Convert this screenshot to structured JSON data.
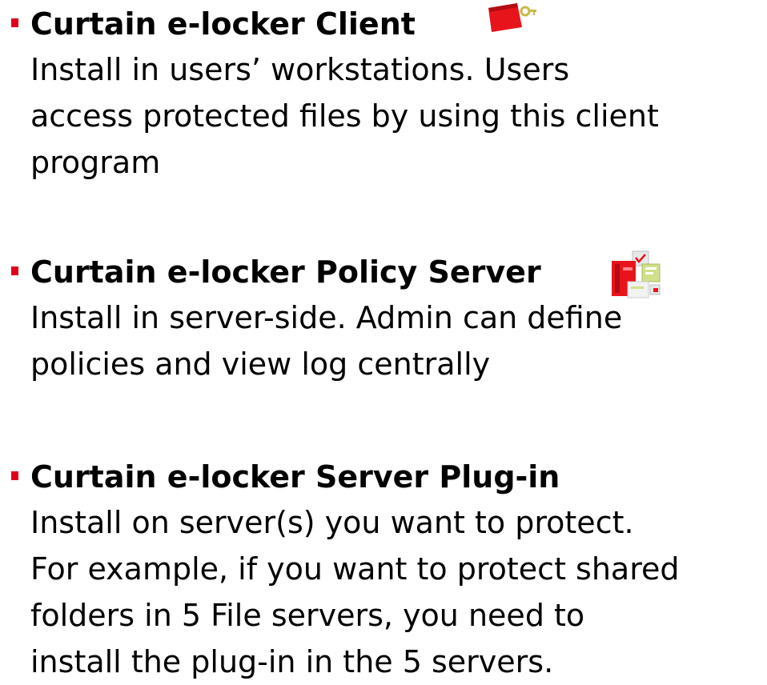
{
  "items": [
    {
      "title": "Curtain e-locker Client",
      "icon": "red-folder-key-icon",
      "lines": [
        " Install in users’ workstations. Users",
        "access protected files by using this client",
        "program"
      ]
    },
    {
      "title": "Curtain e-locker Policy Server",
      "icon": "policy-server-icon",
      "lines": [
        " Install in server-side.  Admin can define",
        "policies and view log centrally"
      ]
    },
    {
      "title": "Curtain e-locker Server Plug-in",
      "lines": [
        " Install on server(s) you want to protect.",
        "For example, if you want to protect shared",
        "folders in 5 File servers, you need to",
        "install the plug-in in the 5 servers."
      ]
    }
  ],
  "colors": {
    "bullet": "#e0001b",
    "text": "#000000",
    "background": "#ffffff"
  }
}
